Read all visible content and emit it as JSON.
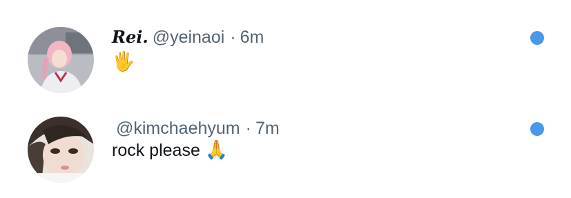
{
  "colors": {
    "unread_dot": "#4a99e9",
    "handle_text": "#536471",
    "body_text": "#0f1419"
  },
  "notifications": [
    {
      "display_name": "Rei.",
      "handle": "@yeinaoi",
      "separator": "·",
      "time": "6m",
      "text": "",
      "emoji": "🖐",
      "emoji_name": "raised-hand-icon",
      "unread": true
    },
    {
      "display_name": "",
      "handle": "@kimchaehyum",
      "separator": "·",
      "time": "7m",
      "text": "rock please",
      "emoji": "🙏",
      "emoji_name": "folded-hands-icon",
      "unread": true
    }
  ]
}
